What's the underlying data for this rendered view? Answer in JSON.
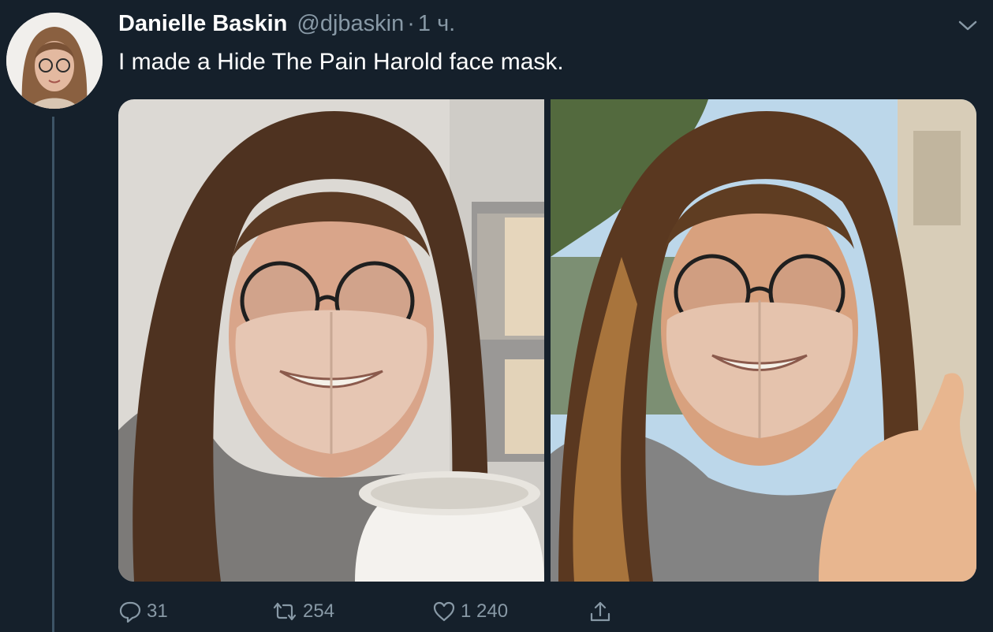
{
  "tweet": {
    "author_name": "Danielle Baskin",
    "author_handle": "@djbaskin",
    "separator": "·",
    "time": "1 ч.",
    "text": "I made a Hide The Pain Harold face mask."
  },
  "actions": {
    "replies": "31",
    "retweets": "254",
    "likes": "1 240"
  },
  "icons": {
    "menu": "chevron-down-icon",
    "reply": "reply-icon",
    "retweet": "retweet-icon",
    "like": "heart-icon",
    "share": "share-icon"
  },
  "colors": {
    "background": "#15202b",
    "text_primary": "#ffffff",
    "text_secondary": "#8899a6",
    "thread_line": "#3d5466"
  }
}
